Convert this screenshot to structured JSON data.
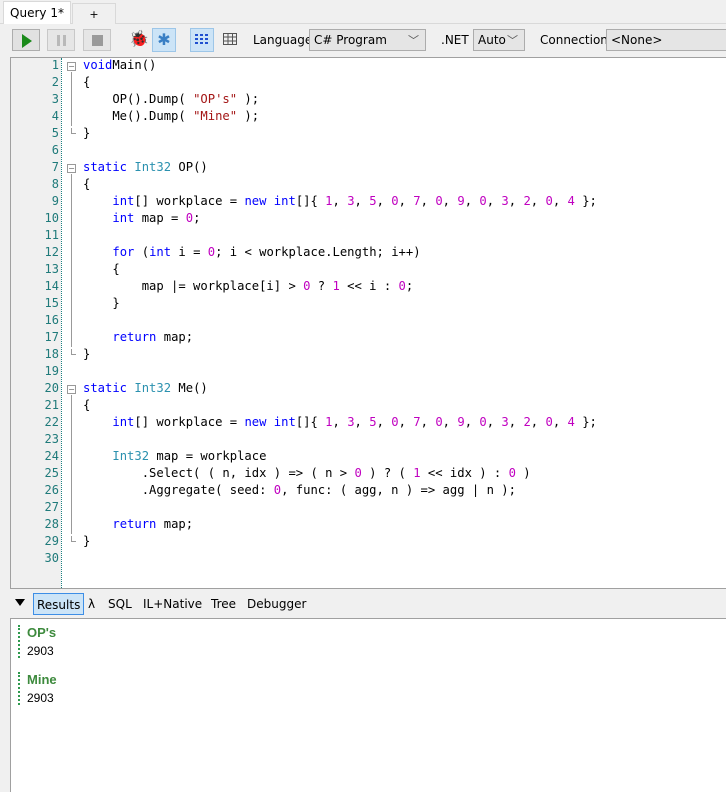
{
  "tabs": {
    "active": "Query 1*",
    "add": "+"
  },
  "toolbar": {
    "language_label": "Language",
    "language_value": "C# Program",
    "net_label": ".NET",
    "net_value": "Auto",
    "connection_label": "Connection",
    "connection_value": "<None>",
    "icons": [
      "run-icon",
      "pause-icon",
      "stop-icon",
      "bug-icon",
      "bug-step-icon",
      "rich-text-results-icon",
      "grid-results-icon"
    ]
  },
  "editor": {
    "lines": [
      [
        [
          "kw",
          "void"
        ],
        [
          "",
          "Main()"
        ]
      ],
      [
        [
          "",
          "{"
        ]
      ],
      [
        [
          "",
          "    OP().Dump( "
        ],
        [
          "st",
          "\"OP's\""
        ],
        [
          "",
          " );"
        ]
      ],
      [
        [
          "",
          "    Me().Dump( "
        ],
        [
          "st",
          "\"Mine\""
        ],
        [
          "",
          " );"
        ]
      ],
      [
        [
          "",
          "}"
        ]
      ],
      [],
      [
        [
          "kw",
          "static"
        ],
        [
          "",
          " "
        ],
        [
          "ty",
          "Int32"
        ],
        [
          "",
          " OP()"
        ]
      ],
      [
        [
          "",
          "{"
        ]
      ],
      [
        [
          "",
          "    "
        ],
        [
          "kw",
          "int"
        ],
        [
          "",
          "[] workplace = "
        ],
        [
          "kw",
          "new"
        ],
        [
          "",
          " "
        ],
        [
          "kw",
          "int"
        ],
        [
          "",
          "[]{ "
        ],
        [
          "nu",
          "1"
        ],
        [
          "",
          ", "
        ],
        [
          "nu",
          "3"
        ],
        [
          "",
          ", "
        ],
        [
          "nu",
          "5"
        ],
        [
          "",
          ", "
        ],
        [
          "nu",
          "0"
        ],
        [
          "",
          ", "
        ],
        [
          "nu",
          "7"
        ],
        [
          "",
          ", "
        ],
        [
          "nu",
          "0"
        ],
        [
          "",
          ", "
        ],
        [
          "nu",
          "9"
        ],
        [
          "",
          ", "
        ],
        [
          "nu",
          "0"
        ],
        [
          "",
          ", "
        ],
        [
          "nu",
          "3"
        ],
        [
          "",
          ", "
        ],
        [
          "nu",
          "2"
        ],
        [
          "",
          ", "
        ],
        [
          "nu",
          "0"
        ],
        [
          "",
          ", "
        ],
        [
          "nu",
          "4"
        ],
        [
          "",
          " };"
        ]
      ],
      [
        [
          "",
          "    "
        ],
        [
          "kw",
          "int"
        ],
        [
          "",
          " map = "
        ],
        [
          "nu",
          "0"
        ],
        [
          "",
          ";"
        ]
      ],
      [],
      [
        [
          "",
          "    "
        ],
        [
          "kw",
          "for"
        ],
        [
          "",
          " ("
        ],
        [
          "kw",
          "int"
        ],
        [
          "",
          " i = "
        ],
        [
          "nu",
          "0"
        ],
        [
          "",
          "; i < workplace.Length; i++)"
        ]
      ],
      [
        [
          "",
          "    {"
        ]
      ],
      [
        [
          "",
          "        map |= workplace[i] > "
        ],
        [
          "nu",
          "0"
        ],
        [
          "",
          " ? "
        ],
        [
          "nu",
          "1"
        ],
        [
          "",
          " << i : "
        ],
        [
          "nu",
          "0"
        ],
        [
          "",
          ";"
        ]
      ],
      [
        [
          "",
          "    }"
        ]
      ],
      [],
      [
        [
          "",
          "    "
        ],
        [
          "kw",
          "return"
        ],
        [
          "",
          " map;"
        ]
      ],
      [
        [
          "",
          "}"
        ]
      ],
      [],
      [
        [
          "kw",
          "static"
        ],
        [
          "",
          " "
        ],
        [
          "ty",
          "Int32"
        ],
        [
          "",
          " Me()"
        ]
      ],
      [
        [
          "",
          "{"
        ]
      ],
      [
        [
          "",
          "    "
        ],
        [
          "kw",
          "int"
        ],
        [
          "",
          "[] workplace = "
        ],
        [
          "kw",
          "new"
        ],
        [
          "",
          " "
        ],
        [
          "kw",
          "int"
        ],
        [
          "",
          "[]{ "
        ],
        [
          "nu",
          "1"
        ],
        [
          "",
          ", "
        ],
        [
          "nu",
          "3"
        ],
        [
          "",
          ", "
        ],
        [
          "nu",
          "5"
        ],
        [
          "",
          ", "
        ],
        [
          "nu",
          "0"
        ],
        [
          "",
          ", "
        ],
        [
          "nu",
          "7"
        ],
        [
          "",
          ", "
        ],
        [
          "nu",
          "0"
        ],
        [
          "",
          ", "
        ],
        [
          "nu",
          "9"
        ],
        [
          "",
          ", "
        ],
        [
          "nu",
          "0"
        ],
        [
          "",
          ", "
        ],
        [
          "nu",
          "3"
        ],
        [
          "",
          ", "
        ],
        [
          "nu",
          "2"
        ],
        [
          "",
          ", "
        ],
        [
          "nu",
          "0"
        ],
        [
          "",
          ", "
        ],
        [
          "nu",
          "4"
        ],
        [
          "",
          " };"
        ]
      ],
      [],
      [
        [
          "",
          "    "
        ],
        [
          "ty",
          "Int32"
        ],
        [
          "",
          " map = workplace"
        ]
      ],
      [
        [
          "",
          "        .Select( ( n, idx ) => ( n > "
        ],
        [
          "nu",
          "0"
        ],
        [
          "",
          " ) ? ( "
        ],
        [
          "nu",
          "1"
        ],
        [
          "",
          " << idx ) : "
        ],
        [
          "nu",
          "0"
        ],
        [
          "",
          " )"
        ]
      ],
      [
        [
          "",
          "        .Aggregate( seed: "
        ],
        [
          "nu",
          "0"
        ],
        [
          "",
          ", func: ( agg, n ) => agg | n );"
        ]
      ],
      [],
      [
        [
          "",
          "    "
        ],
        [
          "kw",
          "return"
        ],
        [
          "",
          " map;"
        ]
      ],
      [
        [
          "",
          "}"
        ]
      ],
      []
    ]
  },
  "output_tabs": [
    "Results",
    "λ",
    "SQL",
    "IL+Native",
    "Tree",
    "Debugger"
  ],
  "results": [
    {
      "title": "OP's",
      "value": "2903"
    },
    {
      "title": "Mine",
      "value": "2903"
    }
  ]
}
